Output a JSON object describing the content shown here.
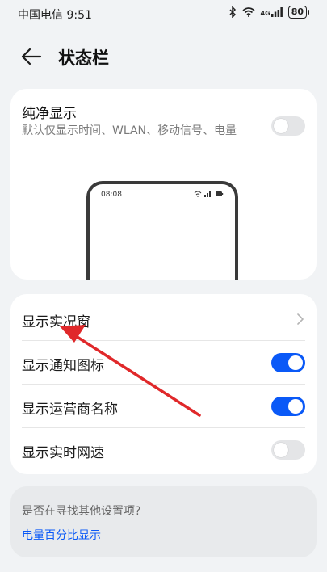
{
  "status_bar": {
    "carrier_time": "中国电信 9:51",
    "network": "4G",
    "battery": "80"
  },
  "header": {
    "title": "状态栏"
  },
  "pure_display": {
    "title": "纯净显示",
    "description": "默认仅显示时间、WLAN、移动信号、电量",
    "enabled": false,
    "preview_time": "08:08"
  },
  "settings": [
    {
      "label": "显示实况窗",
      "control": "chevron"
    },
    {
      "label": "显示通知图标",
      "control": "toggle",
      "enabled": true
    },
    {
      "label": "显示运营商名称",
      "control": "toggle",
      "enabled": true
    },
    {
      "label": "显示实时网速",
      "control": "toggle",
      "enabled": false
    }
  ],
  "search_suggestion": {
    "question": "是否在寻找其他设置项?",
    "link": "电量百分比显示"
  },
  "colors": {
    "accent": "#0a59f7",
    "annotation_arrow": "#e0282a",
    "background": "#f1f3f5"
  }
}
